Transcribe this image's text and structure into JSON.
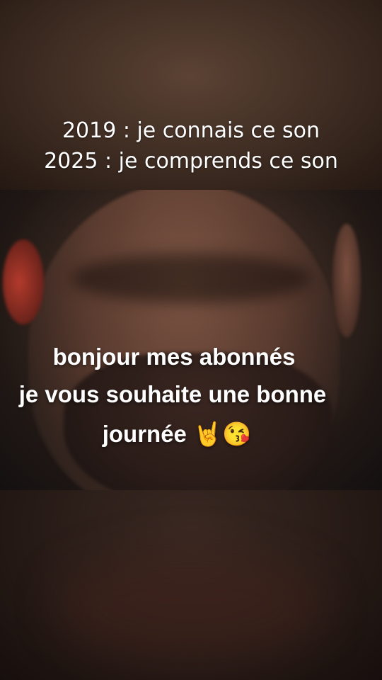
{
  "caption": {
    "line1": "2019 : je connais ce son",
    "line2": "2025 : je comprends ce son"
  },
  "overlay": {
    "line1": "bonjour mes abonnés",
    "line2": "je vous souhaite une bonne",
    "line3": "journée 🤘😘"
  }
}
